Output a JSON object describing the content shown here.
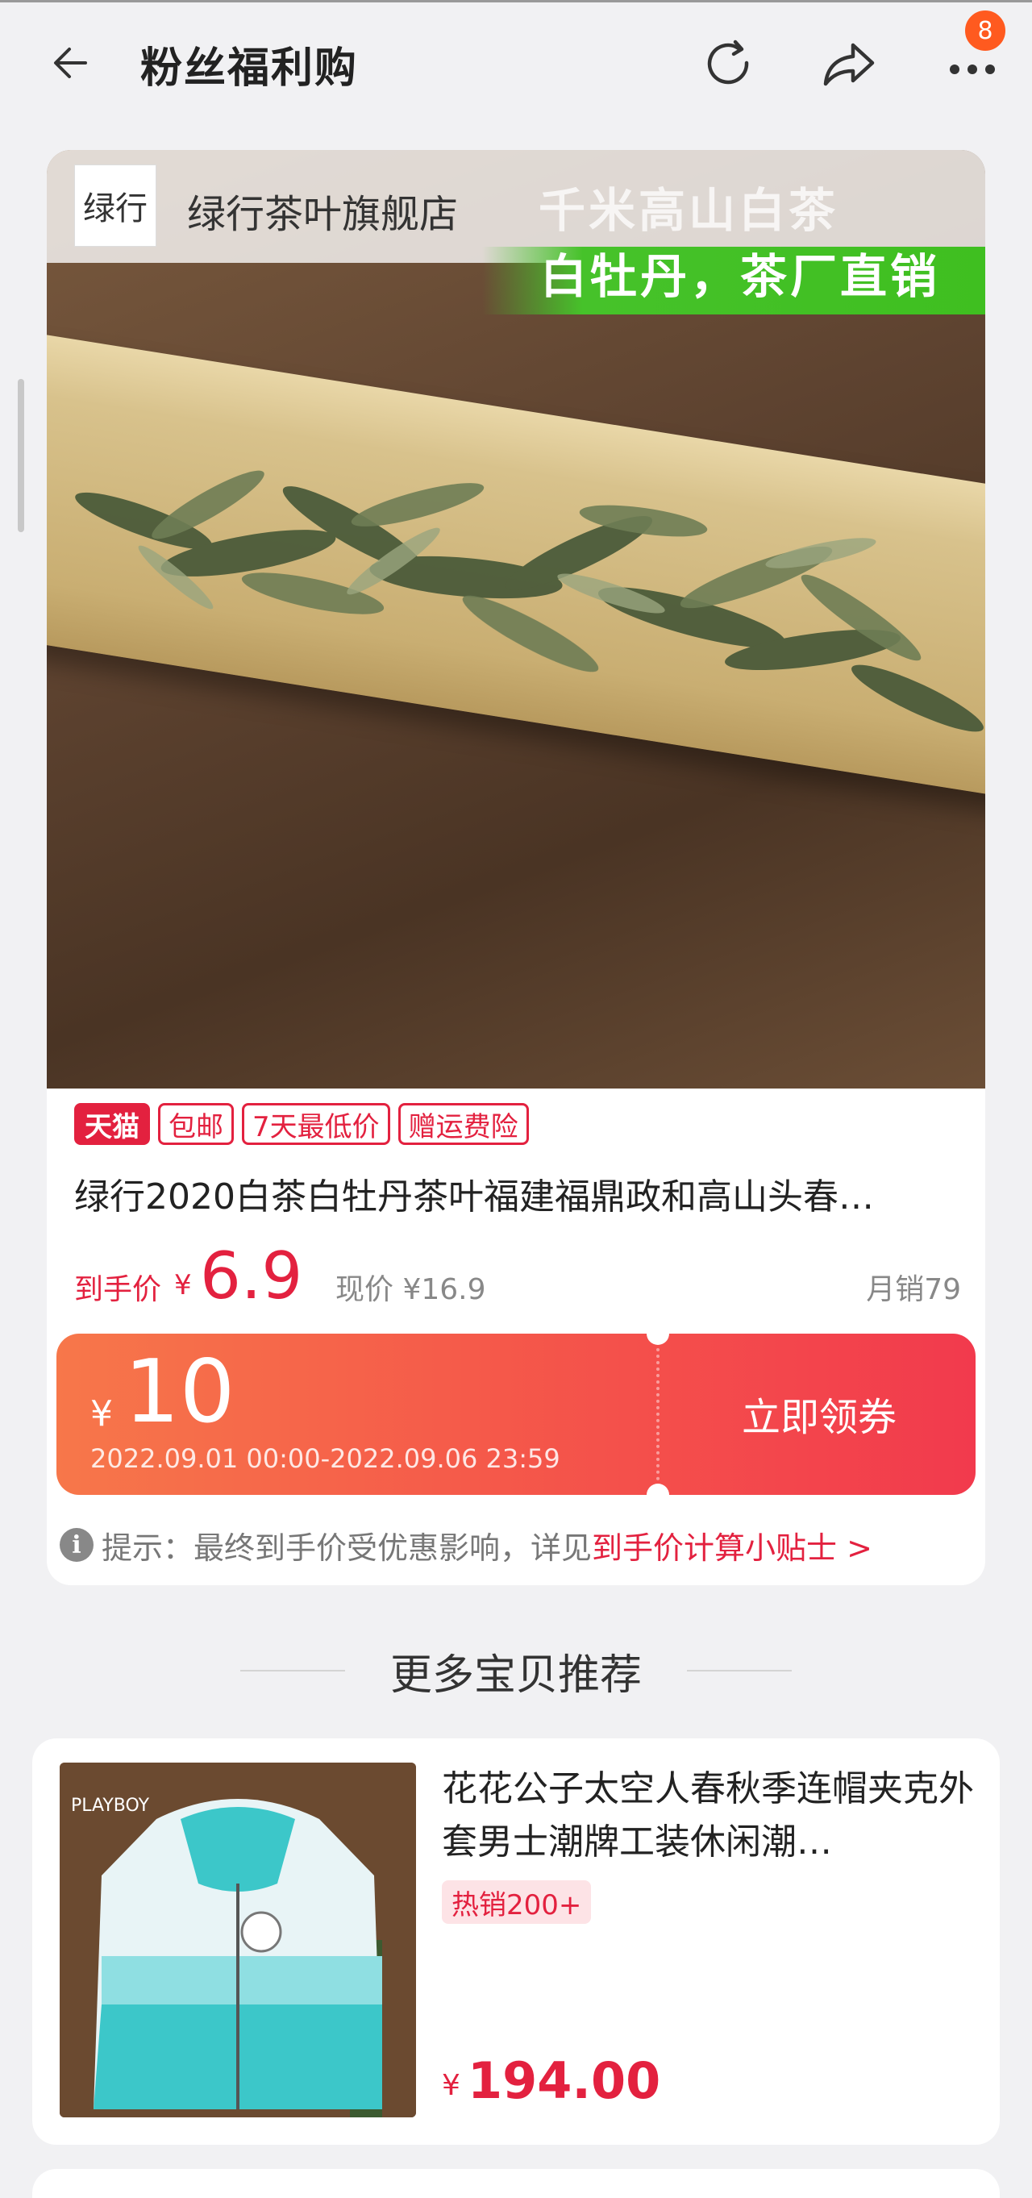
{
  "header": {
    "title": "粉丝福利购",
    "badge_count": "8",
    "icons": [
      "back-arrow-icon",
      "refresh-icon",
      "share-icon",
      "more-icon"
    ]
  },
  "product": {
    "store_name": "绿行茶叶旗舰店",
    "store_logo_text": "绿行",
    "banner_line1": "千米高山白茶",
    "banner_line2": "白牡丹，茶厂直销",
    "tags": [
      "天猫",
      "包邮",
      "7天最低价",
      "赠运费险"
    ],
    "title": "绿行2020白茶白牡丹茶叶福建福鼎政和高山头春…",
    "price_label": "到手价",
    "price_currency": "¥",
    "price": "6.9",
    "original_price": "现价 ¥16.9",
    "monthly_sales": "月销79"
  },
  "coupon": {
    "currency": "¥",
    "amount": "10",
    "dates": "2022.09.01 00:00-2022.09.06 23:59",
    "button_label": "立即领券"
  },
  "tip": {
    "icon": "info-icon",
    "text": "提示：最终到手价受优惠影响，详见",
    "link": "到手价计算小贴士 >"
  },
  "recommend": {
    "heading": "更多宝贝推荐",
    "items": [
      {
        "title": "花花公子太空人春秋季连帽夹克外套男士潮牌工装休闲潮…",
        "tag": "热销200+",
        "currency": "¥",
        "price": "194.00",
        "image_brand": "PLAYBOY"
      }
    ]
  },
  "colors": {
    "accent": "#e3213f",
    "coupon_start": "#f7774a",
    "coupon_end": "#f23a4d",
    "banner_green": "#3fbf20",
    "badge": "#ff5a1f"
  }
}
